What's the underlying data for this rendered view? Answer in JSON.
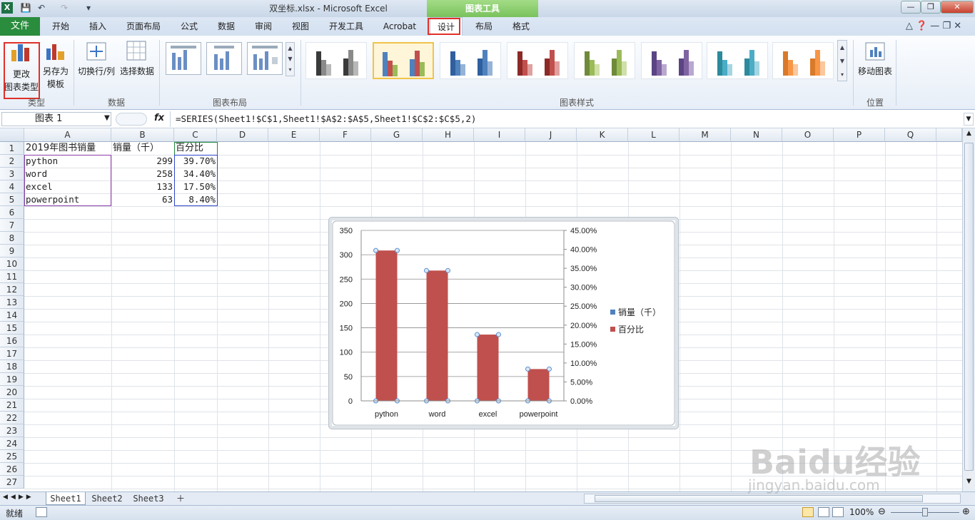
{
  "title_bar": {
    "title": "双坐标.xlsx - Microsoft Excel",
    "chart_tools": "图表工具",
    "min": "—",
    "max": "❐",
    "close": "✕"
  },
  "tabs": {
    "file": "文件",
    "items": [
      "开始",
      "插入",
      "页面布局",
      "公式",
      "数据",
      "审阅",
      "视图",
      "开发工具",
      "Acrobat",
      "设计",
      "布局",
      "格式"
    ]
  },
  "ribbon": {
    "change_type_line1": "更改",
    "change_type_line2": "图表类型",
    "save_template_line1": "另存为",
    "save_template_line2": "模板",
    "switch_rowcol": "切换行/列",
    "select_data": "选择数据",
    "move_chart": "移动图表",
    "groups": {
      "type": "类型",
      "data": "数据",
      "layout": "图表布局",
      "styles": "图表样式",
      "location": "位置"
    }
  },
  "formula_bar": {
    "name_box": "图表 1",
    "fx": "fx",
    "formula": "=SERIES(Sheet1!$C$1,Sheet1!$A$2:$A$5,Sheet1!$C$2:$C$5,2)"
  },
  "columns": [
    "A",
    "B",
    "C",
    "D",
    "E",
    "F",
    "G",
    "H",
    "I",
    "J",
    "K",
    "L",
    "M",
    "N",
    "O",
    "P",
    "Q"
  ],
  "rows": [
    "1",
    "2",
    "3",
    "4",
    "5",
    "6",
    "7",
    "8",
    "9",
    "10",
    "11",
    "12",
    "13",
    "14",
    "15",
    "16",
    "17",
    "18",
    "19",
    "20",
    "21",
    "22",
    "23",
    "24",
    "25",
    "26",
    "27"
  ],
  "cells": {
    "a1": "2019年图书销量",
    "b1": "销量（千）",
    "c1": "百分比",
    "a2": "python",
    "b2": "299",
    "c2": "39.70%",
    "a3": "word",
    "b3": "258",
    "c3": "34.40%",
    "a4": "excel",
    "b4": "133",
    "c4": "17.50%",
    "a5": "powerpoint",
    "b5": "63",
    "c5": "8.40%"
  },
  "chart_data": {
    "type": "bar",
    "categories": [
      "python",
      "word",
      "excel",
      "powerpoint"
    ],
    "series": [
      {
        "name": "销量（千）",
        "values": [
          299,
          258,
          133,
          63
        ],
        "color": "#4f81bd",
        "axis": "primary"
      },
      {
        "name": "百分比",
        "values": [
          0.397,
          0.344,
          0.175,
          0.084
        ],
        "color": "#c0504d",
        "axis": "secondary"
      }
    ],
    "ylim": [
      0,
      350
    ],
    "y_ticks": [
      "0",
      "50",
      "100",
      "150",
      "200",
      "250",
      "300",
      "350"
    ],
    "y2lim": [
      0,
      0.45
    ],
    "y2_ticks": [
      "0.00%",
      "5.00%",
      "10.00%",
      "15.00%",
      "20.00%",
      "25.00%",
      "30.00%",
      "35.00%",
      "40.00%",
      "45.00%"
    ],
    "legend_position": "right",
    "grid": true
  },
  "sheets": [
    "Sheet1",
    "Sheet2",
    "Sheet3"
  ],
  "status": {
    "ready": "就绪",
    "zoom": "100%"
  },
  "watermark": {
    "line1": "Baidu经验",
    "line2": "jingyan.baidu.com"
  }
}
